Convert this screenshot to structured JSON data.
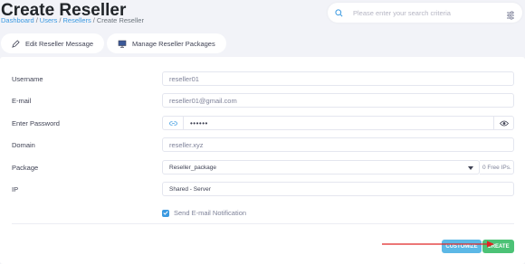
{
  "header": {
    "title": "Create Reseller",
    "breadcrumb": [
      {
        "label": "Dashboard"
      },
      {
        "label": "Users"
      },
      {
        "label": "Resellers"
      },
      {
        "label": "Create Reseller"
      }
    ],
    "separator": "/"
  },
  "search": {
    "placeholder": "Please enter your search criteria"
  },
  "tabs": [
    {
      "label": "Edit Reseller Message",
      "icon": "pencil-icon"
    },
    {
      "label": "Manage Reseller Packages",
      "icon": "monitor-icon"
    }
  ],
  "form": {
    "username": {
      "label": "Username",
      "value": "reseller01"
    },
    "email": {
      "label": "E-mail",
      "value": "reseller01@gmail.com"
    },
    "password": {
      "label": "Enter Password",
      "value": "••••••"
    },
    "domain": {
      "label": "Domain",
      "value": "reseller.xyz"
    },
    "package": {
      "label": "Package",
      "value": "Reseller_package",
      "suffix": "0 Free IPs."
    },
    "ip": {
      "label": "IP",
      "value": "Shared - Server"
    },
    "send_email": {
      "label": "Send E-mail Notification",
      "checked": true
    }
  },
  "actions": {
    "customize_label": "CUSTOMIZE",
    "create_label": "CREATE"
  },
  "colors": {
    "link": "#3b9ae1",
    "customize": "#5cb8e6",
    "create": "#4cc276",
    "annotation_arrow": "#e02424"
  }
}
